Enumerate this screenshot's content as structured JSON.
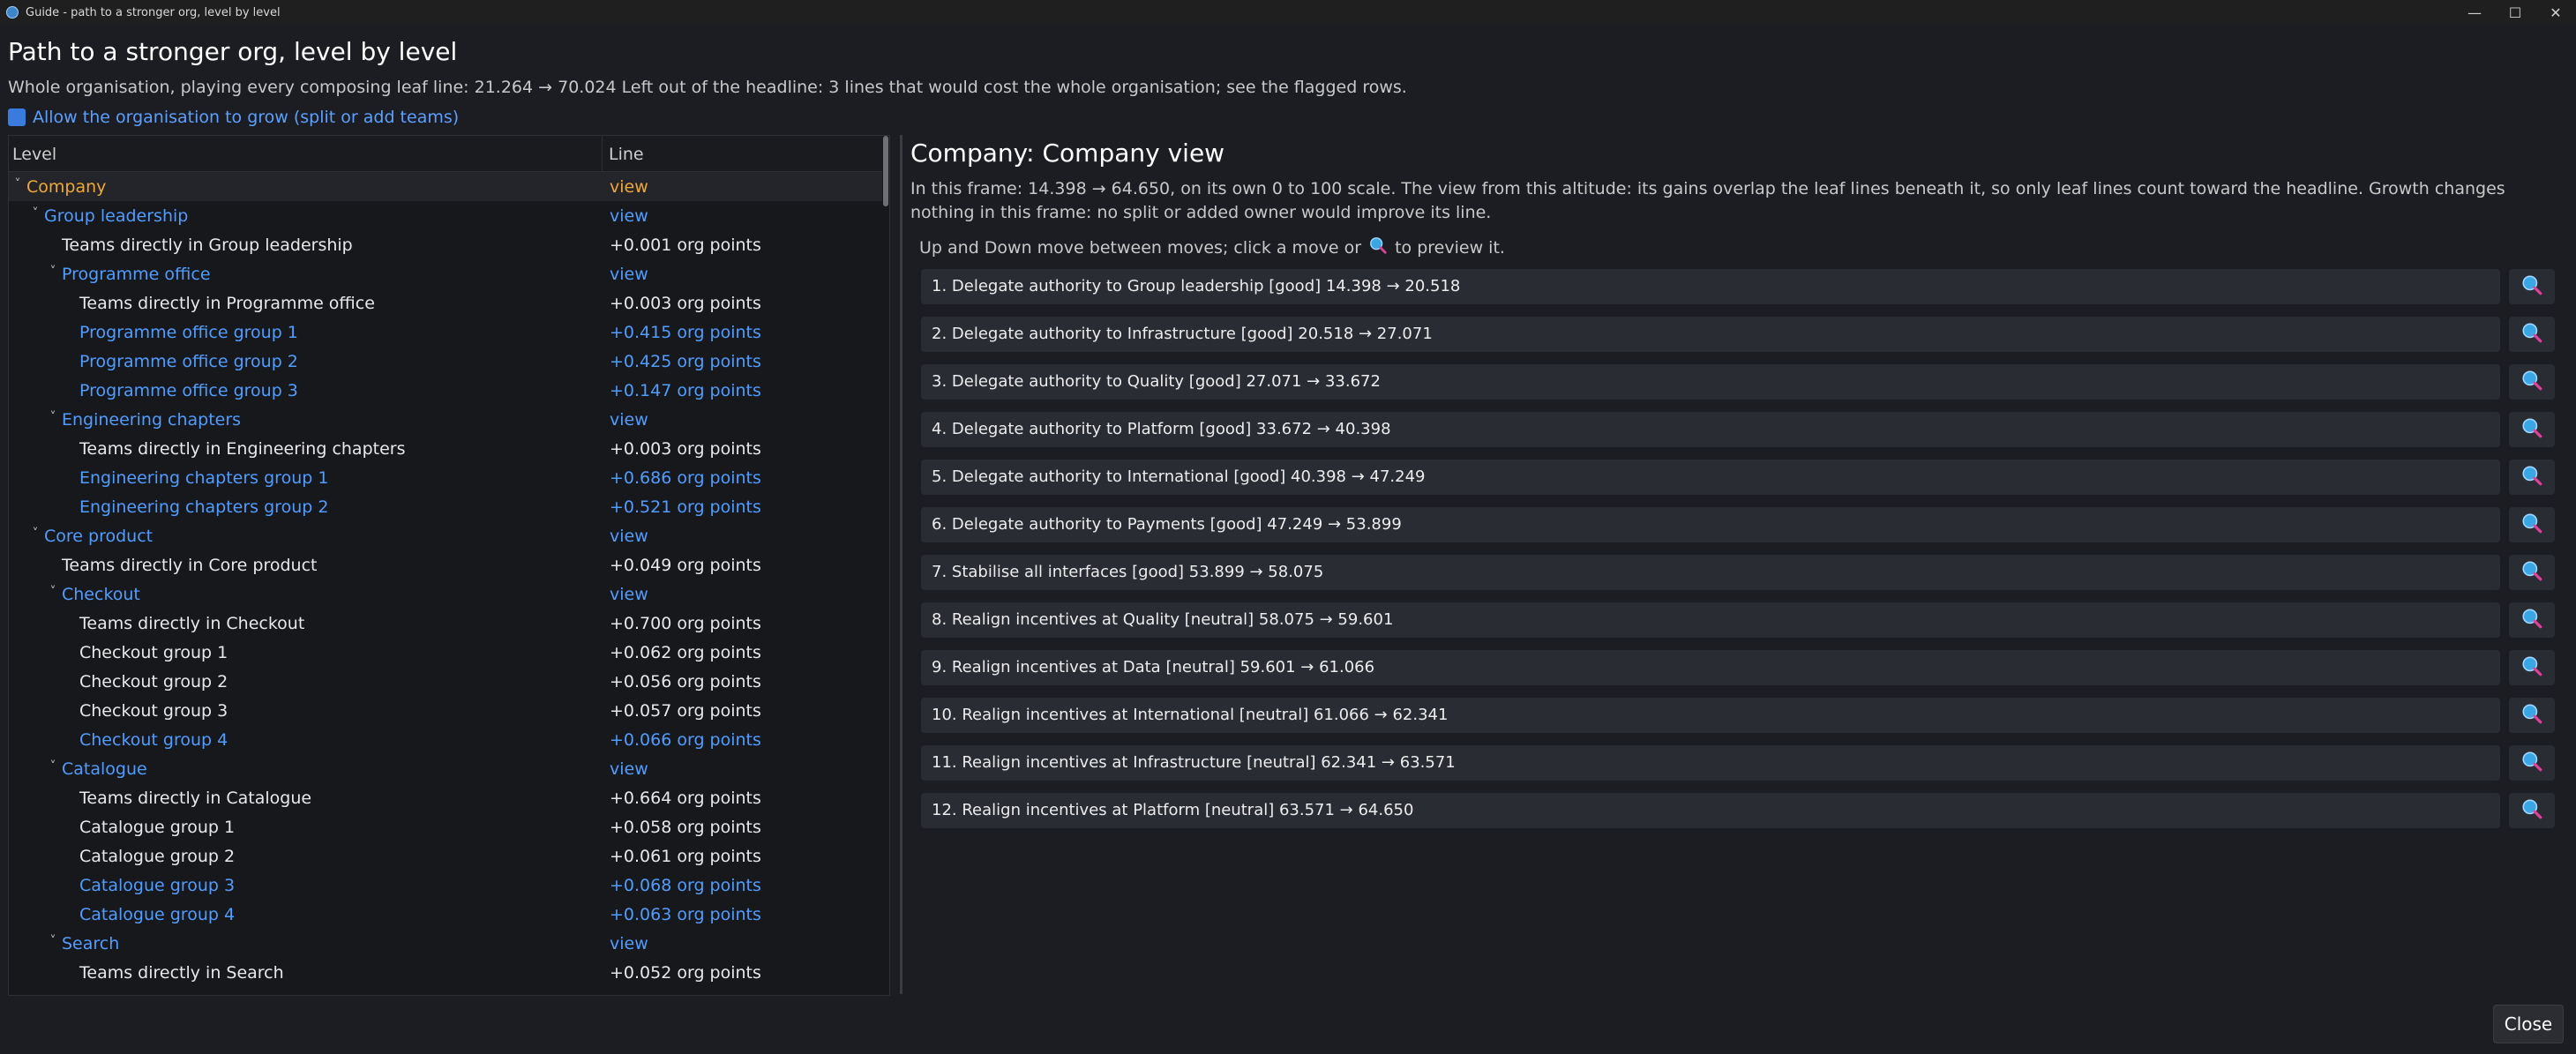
{
  "window": {
    "title": "Guide - path to a stronger org, level by level",
    "controls": {
      "minimize": "—",
      "maximize": "☐",
      "close": "✕"
    }
  },
  "header": {
    "title": "Path to a stronger org, level by level",
    "summary": "Whole organisation, playing every composing leaf line: 21.264 → 70.024   Left out of the headline: 3 lines that would cost the whole organisation; see the flagged rows.",
    "grow_label": "Allow the organisation to grow (split or add teams)",
    "grow_checked": true
  },
  "tree": {
    "columns": {
      "level": "Level",
      "line": "Line"
    },
    "rows": [
      {
        "label": "Company",
        "line": "view",
        "depth": 0,
        "caret": true,
        "color": "gold",
        "selected": true
      },
      {
        "label": "Group leadership",
        "line": "view",
        "depth": 1,
        "caret": true,
        "color": "blue"
      },
      {
        "label": "Teams directly in Group leadership",
        "line": "+0.001 org points",
        "depth": 2,
        "caret": false,
        "color": "white"
      },
      {
        "label": "Programme office",
        "line": "view",
        "depth": 2,
        "caret": true,
        "color": "blue"
      },
      {
        "label": "Teams directly in Programme office",
        "line": "+0.003 org points",
        "depth": 3,
        "caret": false,
        "color": "white"
      },
      {
        "label": "Programme office group 1",
        "line": "+0.415 org points",
        "depth": 3,
        "caret": false,
        "color": "blue"
      },
      {
        "label": "Programme office group 2",
        "line": "+0.425 org points",
        "depth": 3,
        "caret": false,
        "color": "blue"
      },
      {
        "label": "Programme office group 3",
        "line": "+0.147 org points",
        "depth": 3,
        "caret": false,
        "color": "blue"
      },
      {
        "label": "Engineering chapters",
        "line": "view",
        "depth": 2,
        "caret": true,
        "color": "blue"
      },
      {
        "label": "Teams directly in Engineering chapters",
        "line": "+0.003 org points",
        "depth": 3,
        "caret": false,
        "color": "white"
      },
      {
        "label": "Engineering chapters group 1",
        "line": "+0.686 org points",
        "depth": 3,
        "caret": false,
        "color": "blue"
      },
      {
        "label": "Engineering chapters group 2",
        "line": "+0.521 org points",
        "depth": 3,
        "caret": false,
        "color": "blue"
      },
      {
        "label": "Core product",
        "line": "view",
        "depth": 1,
        "caret": true,
        "color": "blue"
      },
      {
        "label": "Teams directly in Core product",
        "line": "+0.049 org points",
        "depth": 2,
        "caret": false,
        "color": "white"
      },
      {
        "label": "Checkout",
        "line": "view",
        "depth": 2,
        "caret": true,
        "color": "blue"
      },
      {
        "label": "Teams directly in Checkout",
        "line": "+0.700 org points",
        "depth": 3,
        "caret": false,
        "color": "white"
      },
      {
        "label": "Checkout group 1",
        "line": "+0.062 org points",
        "depth": 3,
        "caret": false,
        "color": "white"
      },
      {
        "label": "Checkout group 2",
        "line": "+0.056 org points",
        "depth": 3,
        "caret": false,
        "color": "white"
      },
      {
        "label": "Checkout group 3",
        "line": "+0.057 org points",
        "depth": 3,
        "caret": false,
        "color": "white"
      },
      {
        "label": "Checkout group 4",
        "line": "+0.066 org points",
        "depth": 3,
        "caret": false,
        "color": "blue"
      },
      {
        "label": "Catalogue",
        "line": "view",
        "depth": 2,
        "caret": true,
        "color": "blue"
      },
      {
        "label": "Teams directly in Catalogue",
        "line": "+0.664 org points",
        "depth": 3,
        "caret": false,
        "color": "white"
      },
      {
        "label": "Catalogue group 1",
        "line": "+0.058 org points",
        "depth": 3,
        "caret": false,
        "color": "white"
      },
      {
        "label": "Catalogue group 2",
        "line": "+0.061 org points",
        "depth": 3,
        "caret": false,
        "color": "white"
      },
      {
        "label": "Catalogue group 3",
        "line": "+0.068 org points",
        "depth": 3,
        "caret": false,
        "color": "blue"
      },
      {
        "label": "Catalogue group 4",
        "line": "+0.063 org points",
        "depth": 3,
        "caret": false,
        "color": "blue"
      },
      {
        "label": "Search",
        "line": "view",
        "depth": 2,
        "caret": true,
        "color": "blue"
      },
      {
        "label": "Teams directly in Search",
        "line": "+0.052 org points",
        "depth": 3,
        "caret": false,
        "color": "white"
      }
    ]
  },
  "detail": {
    "title": "Company: Company   view",
    "description": "In this frame: 14.398 → 64.650, on its own 0 to 100 scale. The view from this altitude: its gains overlap the leaf lines beneath it, so only leaf lines count toward the headline. Growth changes nothing in this frame: no split or added owner would improve its line.",
    "hint_before": "Up and Down move between moves; click a move or",
    "hint_after": "to preview it.",
    "moves": [
      "1. Delegate authority to Group leadership   [good]   14.398 → 20.518",
      "2. Delegate authority to Infrastructure   [good]   20.518 → 27.071",
      "3. Delegate authority to Quality   [good]   27.071 → 33.672",
      "4. Delegate authority to Platform   [good]   33.672 → 40.398",
      "5. Delegate authority to International   [good]   40.398 → 47.249",
      "6. Delegate authority to Payments   [good]   47.249 → 53.899",
      "7. Stabilise all interfaces   [good]   53.899 → 58.075",
      "8. Realign incentives at Quality   [neutral]   58.075 → 59.601",
      "9. Realign incentives at Data   [neutral]   59.601 → 61.066",
      "10. Realign incentives at International   [neutral]   61.066 → 62.341",
      "11. Realign incentives at Infrastructure   [neutral]   62.341 → 63.571",
      "12. Realign incentives at Platform   [neutral]   63.571 → 64.650"
    ]
  },
  "footer": {
    "close_label": "Close"
  },
  "colors": {
    "gold": "#f0a82e",
    "blue": "#4f9dff",
    "white": "#e8e8e8",
    "accent": "#3a7be0"
  },
  "icons": {
    "preview": "magnifier-icon",
    "caret": "chevron-down-icon"
  }
}
